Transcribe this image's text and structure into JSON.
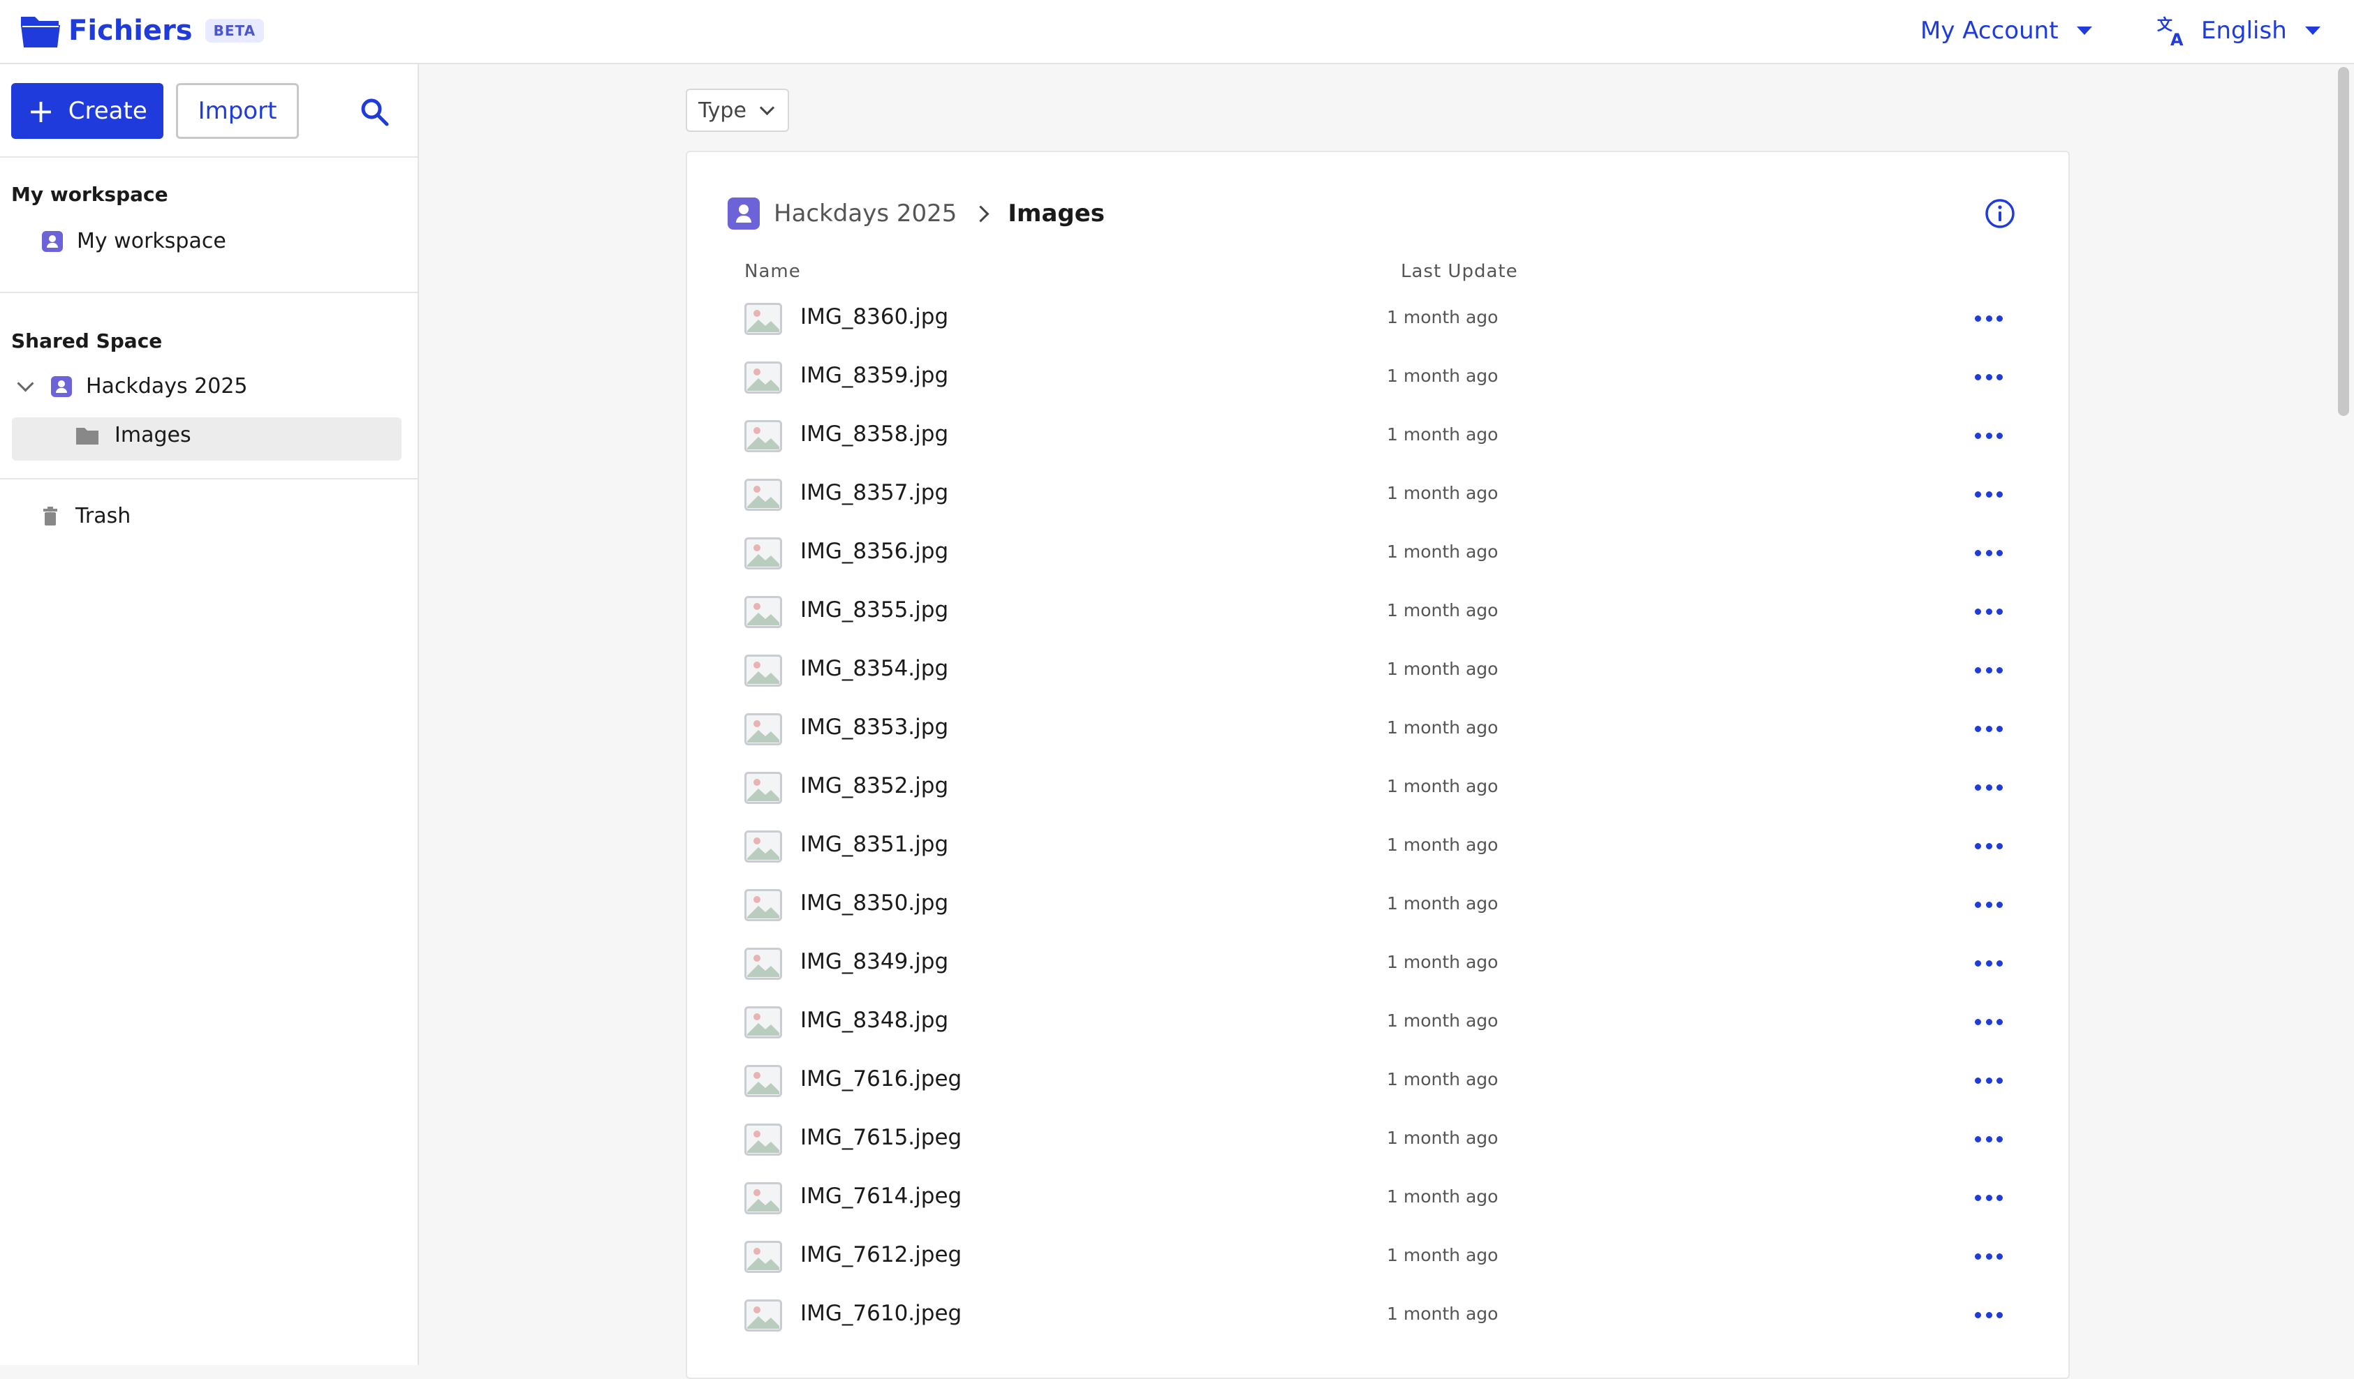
{
  "header": {
    "app_name": "Fichiers",
    "badge": "BETA",
    "account_label": "My Account",
    "language_label": "English"
  },
  "sidebar": {
    "create_label": "Create",
    "import_label": "Import",
    "my_workspace_title": "My workspace",
    "my_workspace_item": "My workspace",
    "shared_space_title": "Shared Space",
    "shared_workspace_item": "Hackdays 2025",
    "shared_folder_item": "Images",
    "trash_label": "Trash"
  },
  "main": {
    "filter_type_label": "Type",
    "breadcrumb": {
      "parent": "Hackdays 2025",
      "current": "Images"
    },
    "columns": {
      "name": "Name",
      "last_update": "Last Update"
    },
    "files": [
      {
        "name": "IMG_8360.jpg",
        "updated": "1 month ago"
      },
      {
        "name": "IMG_8359.jpg",
        "updated": "1 month ago"
      },
      {
        "name": "IMG_8358.jpg",
        "updated": "1 month ago"
      },
      {
        "name": "IMG_8357.jpg",
        "updated": "1 month ago"
      },
      {
        "name": "IMG_8356.jpg",
        "updated": "1 month ago"
      },
      {
        "name": "IMG_8355.jpg",
        "updated": "1 month ago"
      },
      {
        "name": "IMG_8354.jpg",
        "updated": "1 month ago"
      },
      {
        "name": "IMG_8353.jpg",
        "updated": "1 month ago"
      },
      {
        "name": "IMG_8352.jpg",
        "updated": "1 month ago"
      },
      {
        "name": "IMG_8351.jpg",
        "updated": "1 month ago"
      },
      {
        "name": "IMG_8350.jpg",
        "updated": "1 month ago"
      },
      {
        "name": "IMG_8349.jpg",
        "updated": "1 month ago"
      },
      {
        "name": "IMG_8348.jpg",
        "updated": "1 month ago"
      },
      {
        "name": "IMG_7616.jpeg",
        "updated": "1 month ago"
      },
      {
        "name": "IMG_7615.jpeg",
        "updated": "1 month ago"
      },
      {
        "name": "IMG_7614.jpeg",
        "updated": "1 month ago"
      },
      {
        "name": "IMG_7612.jpeg",
        "updated": "1 month ago"
      },
      {
        "name": "IMG_7610.jpeg",
        "updated": "1 month ago"
      }
    ]
  },
  "icons": {
    "logo": "folder-icon",
    "language": "translate-icon",
    "search": "search-icon",
    "info": "info-icon",
    "file": "image-file-icon",
    "more": "more-horizontal-icon",
    "trash": "trash-icon",
    "folder": "folder-icon"
  },
  "colors": {
    "accent": "#1f3bdb",
    "workspace": "#6c63d9",
    "selected_bg": "#ececec"
  }
}
